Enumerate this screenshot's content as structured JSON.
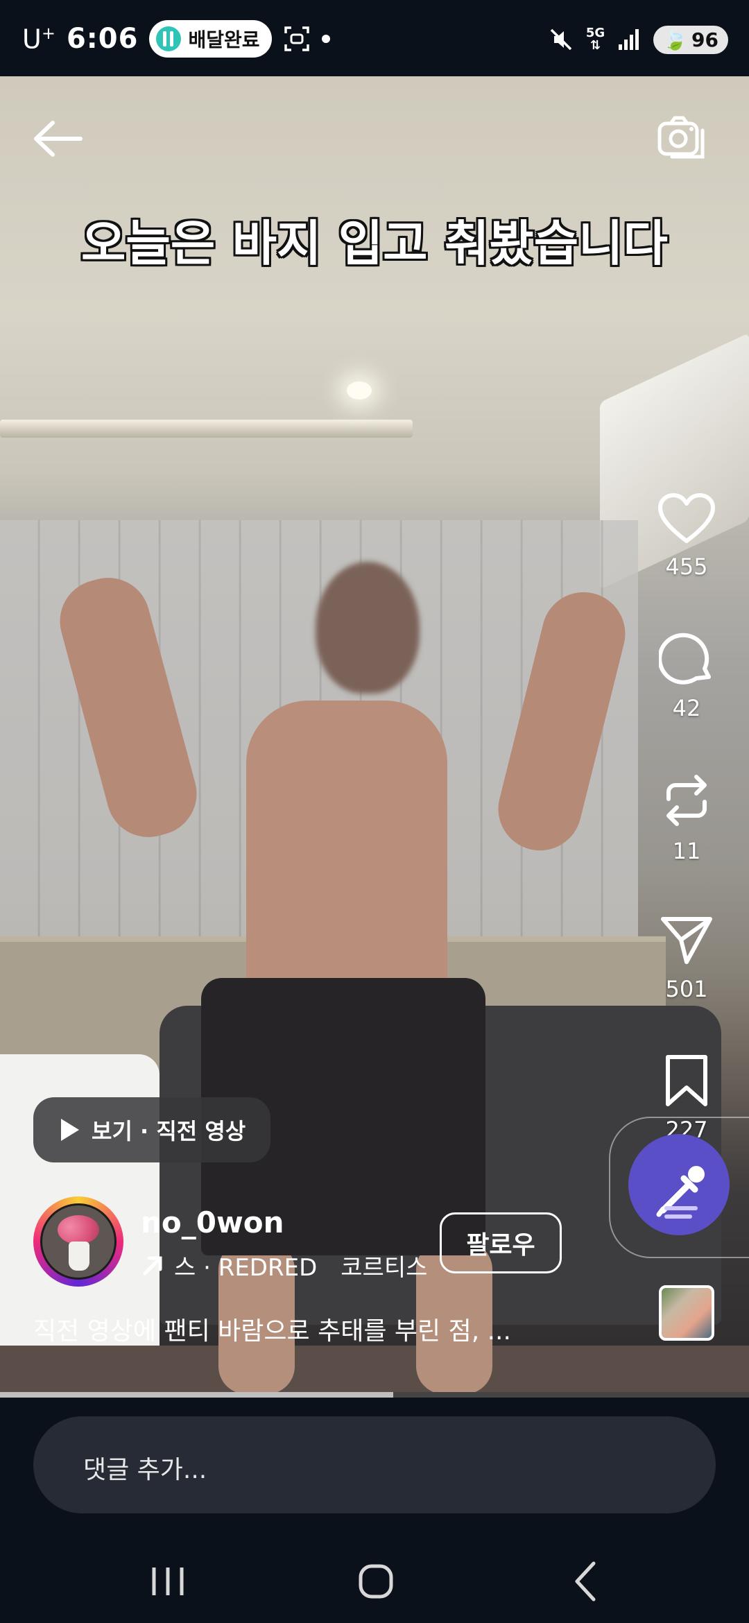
{
  "status_bar": {
    "carrier": "U",
    "carrier_sup": "+",
    "time": "6:06",
    "notification_pill": "배달완료",
    "network": "5G",
    "battery": "96"
  },
  "video": {
    "caption": "오늘은 바지 입고 춰봤습니다"
  },
  "actions": {
    "like_count": "455",
    "comment_count": "42",
    "repost_count": "11",
    "share_count": "501",
    "save_count": "227"
  },
  "watch_chip": {
    "label": "보기 · 직전 영상"
  },
  "author": {
    "username": "no_0won",
    "audio_label": "스 · REDRED",
    "audio_label_2": "코르티스",
    "follow_label": "팔로우"
  },
  "description": "직전 영상에 팬티 바람으로 추태를 부린 점, ...",
  "progress": 0.525,
  "comment_input": {
    "placeholder": "댓글 추가..."
  },
  "colors": {
    "background": "#0b111b",
    "music_button": "#5b4fc7",
    "comment_bar": "#262b35"
  }
}
